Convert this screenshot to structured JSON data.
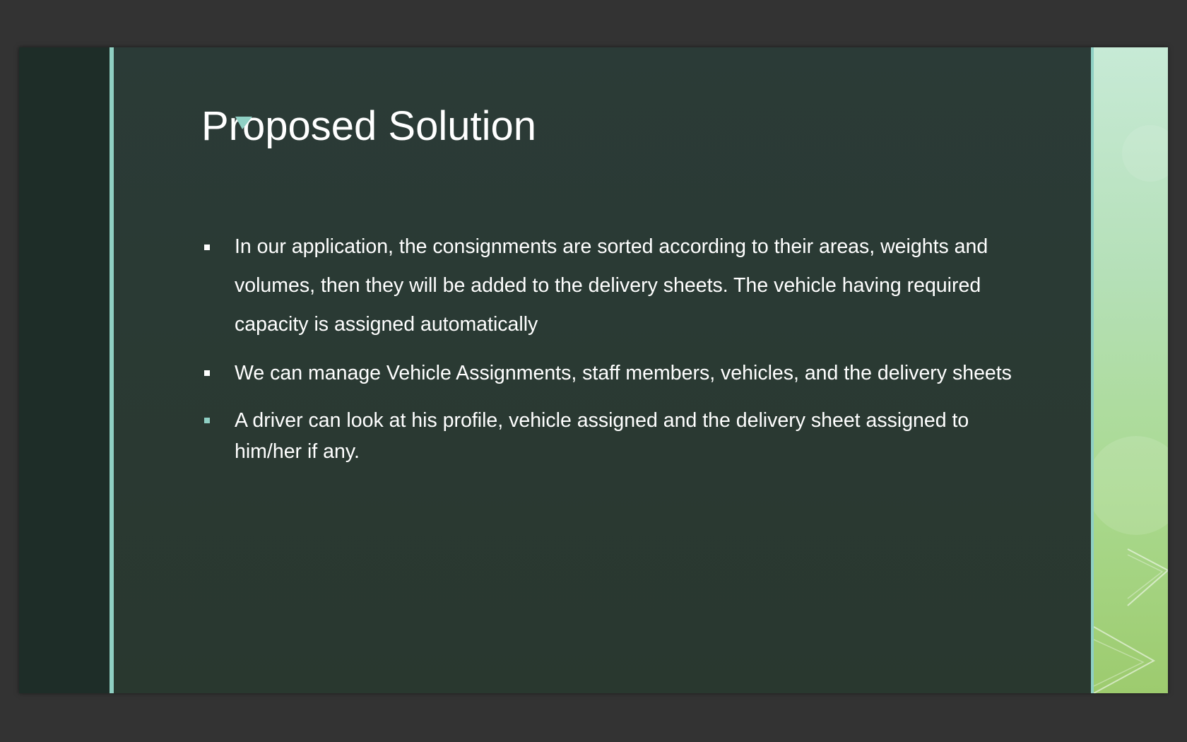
{
  "slide": {
    "title": "Proposed Solution",
    "bullets": [
      "In our application, the consignments are sorted according to their areas, weights and volumes, then they will be added to the delivery sheets. The vehicle having required capacity is assigned automatically",
      "We can manage Vehicle Assignments, staff members, vehicles, and the delivery sheets",
      "A driver can look at his profile, vehicle assigned and the delivery sheet assigned to him/her if any."
    ]
  },
  "colors": {
    "background": "#333333",
    "slide": "#2b3b37",
    "left_band": "#1e2d28",
    "accent_teal": "#8fcfc2",
    "right_band_top": "#c7ead6",
    "right_band_bottom": "#9dcb6e",
    "text": "#ffffff"
  },
  "icons": {
    "title_mark": "triangle-accent-icon",
    "bullet_marker": "square-bullet-icon"
  }
}
